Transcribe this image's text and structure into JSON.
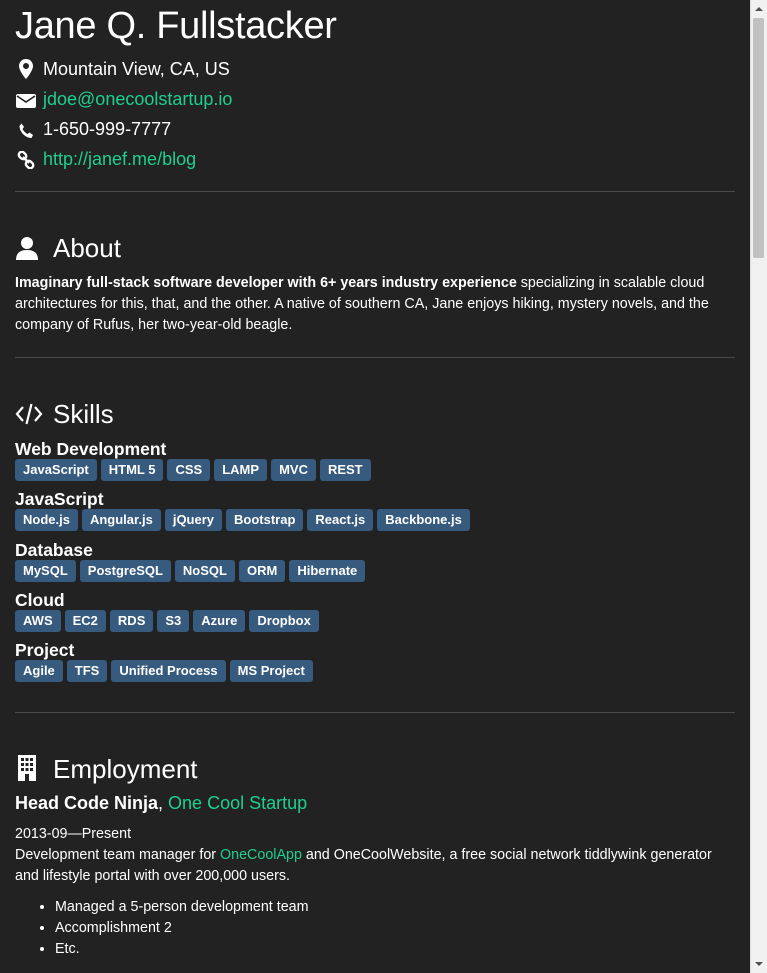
{
  "header": {
    "name": "Jane Q. Fullstacker",
    "location": "Mountain View, CA, US",
    "email": "jdoe@onecoolstartup.io",
    "phone": "1-650-999-7777",
    "website": "http://janef.me/blog",
    "icons": [
      "map-marker-icon",
      "envelope-icon",
      "phone-icon",
      "link-icon"
    ]
  },
  "about": {
    "title": "About",
    "icon": "user-icon",
    "summary_bold": "Imaginary full-stack software developer with 6+ years industry experience",
    "summary_rest": " specializing in scalable cloud architectures for this, that, and the other. A native of southern CA, Jane enjoys hiking, mystery novels, and the company of Rufus, her two-year-old beagle."
  },
  "skills": {
    "title": "Skills",
    "icon": "code-icon",
    "groups": [
      {
        "name": "Web Development",
        "keywords": [
          "JavaScript",
          "HTML 5",
          "CSS",
          "LAMP",
          "MVC",
          "REST"
        ]
      },
      {
        "name": "JavaScript",
        "keywords": [
          "Node.js",
          "Angular.js",
          "jQuery",
          "Bootstrap",
          "React.js",
          "Backbone.js"
        ]
      },
      {
        "name": "Database",
        "keywords": [
          "MySQL",
          "PostgreSQL",
          "NoSQL",
          "ORM",
          "Hibernate"
        ]
      },
      {
        "name": "Cloud",
        "keywords": [
          "AWS",
          "EC2",
          "RDS",
          "S3",
          "Azure",
          "Dropbox"
        ]
      },
      {
        "name": "Project",
        "keywords": [
          "Agile",
          "TFS",
          "Unified Process",
          "MS Project"
        ]
      }
    ]
  },
  "employment": {
    "title": "Employment",
    "icon": "building-icon",
    "jobs": [
      {
        "role": "Head Code Ninja",
        "separator": ", ",
        "company": "One Cool Startup",
        "dates": "2013-09—Present",
        "desc_before": "Development team manager for ",
        "desc_link": "OneCoolApp",
        "desc_after": " and OneCoolWebsite, a free social network tiddlywink generator and lifestyle portal with over 200,000 users.",
        "highlights": [
          "Managed a 5-person development team",
          "Accomplishment 2",
          "Etc."
        ]
      }
    ]
  },
  "colors": {
    "background": "#222222",
    "accent_link": "#1ed08e",
    "tag_background": "#375a7f",
    "text": "#ffffff"
  }
}
